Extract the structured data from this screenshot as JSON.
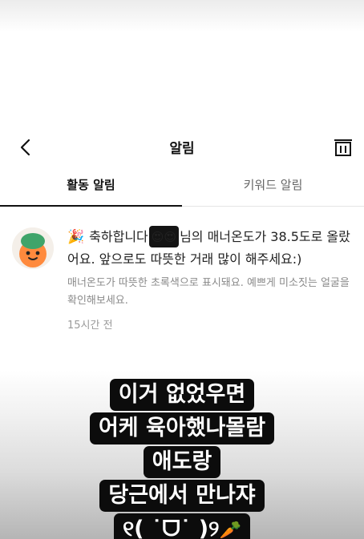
{
  "header": {
    "title": "알림"
  },
  "tabs": [
    {
      "label": "활동 알림",
      "active": true
    },
    {
      "label": "키워드 알림",
      "active": false
    }
  ],
  "notification": {
    "icon": "party-popper-icon",
    "msg_before": "축하합니다",
    "redacted_emoji": "😍😍",
    "msg_after": "님의 매너온도가 38.5도로 올랐어요. 앞으로도 따뜻한 거래 많이 해주세요:)",
    "sub": "매너온도가 따뜻한 초록색으로 표시돼요. 예쁘게 미소짓는 얼굴을 확인해보세요.",
    "time": "15시간 전"
  },
  "captions": [
    "이거 없었우면",
    "어케 육아했나몰람",
    "애도랑",
    "당근에서 만나쟈",
    "୧( ˙ᗜ˙ )୨"
  ],
  "caption_emoji": "🥕",
  "colors": {
    "text": "#212124",
    "muted": "#8a8a8a",
    "caption_bg": "#0c0c0c",
    "avatar_accent": "#ff7e36",
    "avatar_leaf": "#3fa46a"
  }
}
